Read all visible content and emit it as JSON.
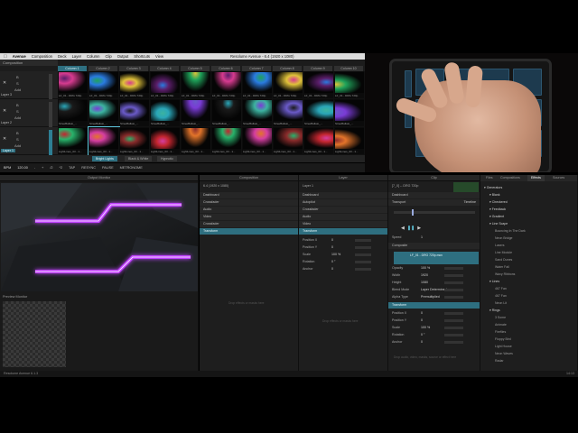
{
  "menubar": {
    "app_name": "Avenue",
    "items": [
      "Composition",
      "Deck",
      "Layer",
      "Column",
      "Clip",
      "Output",
      "Shortcuts",
      "View"
    ],
    "window_title": "Resolume Avenue - 6.4 (1920 x 1080)"
  },
  "grid": {
    "header_label": "Composition",
    "columns": [
      "Column 1",
      "Column 2",
      "Column 3",
      "Column 4",
      "Column 5",
      "Column 6",
      "Column 7",
      "Column 8",
      "Column 9",
      "Column 10"
    ],
    "active_column": 0,
    "layers": [
      {
        "name": "Layer 3",
        "active": false,
        "clips": [
          "LF_01 - DRG 720p",
          "LF_01 - DRG 720p",
          "LF_01 - DRG 720p",
          "LF_01 - DRG 720p",
          "LF_01 - DRG 720p",
          "LF_01 - DRG 720p",
          "LF_01 - DRG 720p",
          "LF_01 - DRG 720p",
          "LF_01 - DRG 720p",
          "LF_01 - DRG 720p"
        ]
      },
      {
        "name": "Layer 2",
        "active": false,
        "clips": [
          "StreeBallaio_...",
          "StreeBallaio_...",
          "StreeBallaio_...",
          "StreeBallaio_...",
          "StreeBallaio_...",
          "StreeBallaio_...",
          "StreeBallaio_...",
          "StreeBallaio_...",
          "StreeBallaio_...",
          "StreeBallaio_..."
        ]
      },
      {
        "name": "Layer 1",
        "active": true,
        "clips": [
          "LightLines_03 - 1...",
          "LightLines_03 - 1...",
          "LightLines_03 - 1...",
          "LightLines_03 - 1...",
          "LightLines_03 - 1...",
          "LightLines_03 - 1...",
          "LightLines_03 - 1...",
          "LightLines_03 - 1...",
          "LightLines_03 - 1...",
          "LightLines_03 - 1..."
        ]
      }
    ],
    "decks": [
      "Bright Lights",
      "Black & White",
      "Hypnotic"
    ],
    "active_deck": 0
  },
  "transport": {
    "bpm_label": "BPM",
    "bpm_value": "120.00",
    "controls": [
      "-",
      "+",
      "/2",
      "*2",
      "TAP",
      "RESYNC",
      "PAUSE",
      "METRONOME"
    ]
  },
  "output_monitor": {
    "title": "Output Monitor",
    "preview_label": "Preview Monitor"
  },
  "composition_panel": {
    "title": "Composition",
    "name": "6.4 (1920 x 1080)",
    "sections": [
      "Dashboard",
      "Crossfader",
      "Audio",
      "Video",
      "Crossfader",
      "Transform"
    ],
    "hint": "Drop effects or masks here"
  },
  "layer_panel": {
    "title": "Layer",
    "name": "Layer 1",
    "sections": [
      "Dashboard",
      "Autopilot",
      "Crossfader",
      "Audio",
      "Video",
      "Transform"
    ],
    "params": [
      {
        "label": "Position X",
        "value": "0"
      },
      {
        "label": "Position Y",
        "value": "0"
      },
      {
        "label": "Scale",
        "value": "100 %"
      },
      {
        "label": "Rotation",
        "value": "0 °"
      },
      {
        "label": "Anchor",
        "value": "0"
      }
    ],
    "hint": "Drop effects or masks here"
  },
  "clip_panel": {
    "title": "Clip",
    "name": "[7_0] -- DRG 720p",
    "sections": [
      "Dashboard",
      "Transport",
      "Composite",
      "Transform"
    ],
    "transport_mode": "Timeline",
    "speed_label": "Speed",
    "speed_value": "1",
    "source_info": "LF_01 - DRG 720p.mov",
    "params": [
      {
        "label": "Opacity",
        "value": "100 %"
      },
      {
        "label": "Width",
        "value": "1920"
      },
      {
        "label": "Height",
        "value": "1080"
      },
      {
        "label": "Blend Mode",
        "value": "Layer Determined"
      },
      {
        "label": "Alpha Type",
        "value": "Premultiplied"
      }
    ],
    "transform_params": [
      {
        "label": "Position X",
        "value": "0"
      },
      {
        "label": "Position Y",
        "value": "0"
      },
      {
        "label": "Scale",
        "value": "100 %"
      },
      {
        "label": "Rotation",
        "value": "0 °"
      },
      {
        "label": "Anchor",
        "value": "0"
      }
    ],
    "hint": "Drop audio, video, masks, source or effect here"
  },
  "browser": {
    "tabs": [
      "Files",
      "Compositions",
      "Effects",
      "Sources"
    ],
    "active_tab": 2,
    "tree": [
      {
        "label": "Generators",
        "level": 0
      },
      {
        "label": "Blank",
        "level": 1
      },
      {
        "label": "Checkered",
        "level": 1
      },
      {
        "label": "Feedback",
        "level": 1
      },
      {
        "label": "Gradient",
        "level": 1
      },
      {
        "label": "Line Scape",
        "level": 1
      },
      {
        "label": "Bouncing In The Dark",
        "level": 2
      },
      {
        "label": "Neon Bridge",
        "level": 2
      },
      {
        "label": "Lasers",
        "level": 2
      },
      {
        "label": "Line Module",
        "level": 2
      },
      {
        "label": "Sand Dunes",
        "level": 2
      },
      {
        "label": "Water Fall",
        "level": 2
      },
      {
        "label": "Wavy Ribbons",
        "level": 2
      },
      {
        "label": "Lines",
        "level": 1
      },
      {
        "label": "467 Fan",
        "level": 2
      },
      {
        "label": "467 Fan",
        "level": 2
      },
      {
        "label": "Neon Lit",
        "level": 2
      },
      {
        "label": "Rings",
        "level": 1
      },
      {
        "label": "3 Some",
        "level": 2
      },
      {
        "label": "Animate",
        "level": 2
      },
      {
        "label": "Fireflies",
        "level": 2
      },
      {
        "label": "Floppy Bird",
        "level": 2
      },
      {
        "label": "Light House",
        "level": 2
      },
      {
        "label": "Neon Waves",
        "level": 2
      },
      {
        "label": "Radar",
        "level": 2
      }
    ]
  },
  "status": {
    "version": "Resolume Avenue 6.1.3",
    "time": "14:13"
  },
  "colors": {
    "accent": "#2e6f80",
    "neon_purple": "#c040ff",
    "pad_blue": "#1d3a4e"
  }
}
